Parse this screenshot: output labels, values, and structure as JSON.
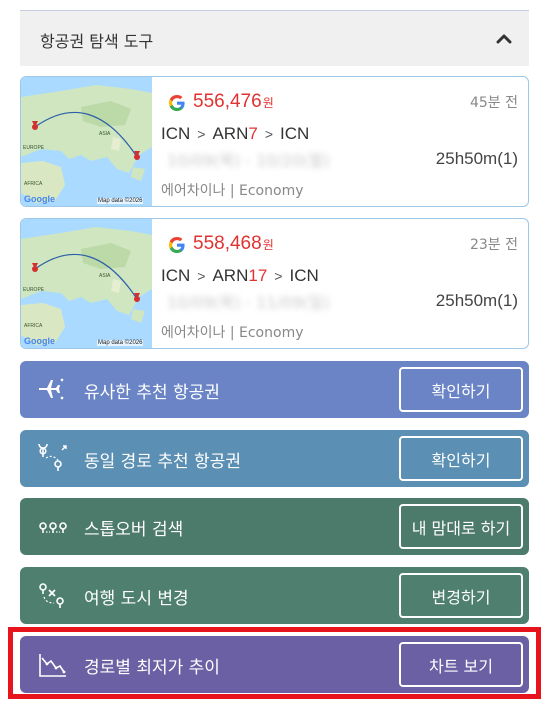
{
  "panel": {
    "title": "항공권 탐색 도구",
    "toggle_icon": "chevron-up-icon"
  },
  "map": {
    "google": "Google",
    "credit": "Map data ©2026",
    "labels": [
      "EUROPE",
      "ASIA",
      "AFRICA"
    ]
  },
  "flights": [
    {
      "price": "556,476",
      "unit": "원",
      "ago": "45분 전",
      "route": {
        "from": "ICN",
        "via": "ARN",
        "stops": "7",
        "to": "ICN"
      },
      "dates_blurred": "10/09(목) - 10/20(월)",
      "duration": "25h50m(1)",
      "airline": "에어차이나 | Economy"
    },
    {
      "price": "558,468",
      "unit": "원",
      "ago": "23분 전",
      "route": {
        "from": "ICN",
        "via": "ARN",
        "stops": "17",
        "to": "ICN"
      },
      "dates_blurred": "10/09(목) - 11/09(일)",
      "duration": "25h50m(1)",
      "airline": "에어차이나 | Economy"
    }
  ],
  "actions": [
    {
      "label": "유사한 추천 항공권",
      "button": "확인하기",
      "color": "#6a84c6",
      "icon": "plane-transfer-icon"
    },
    {
      "label": "동일 경로 추천 항공권",
      "button": "확인하기",
      "color": "#5b8fb3",
      "icon": "route-pins-icon"
    },
    {
      "label": "스톱오버 검색",
      "button": "내 맘대로 하기",
      "color": "#4c7a6b",
      "icon": "stopover-path-icon"
    },
    {
      "label": "여행 도시 변경",
      "button": "변경하기",
      "color": "#4e7f6f",
      "icon": "change-city-icon"
    },
    {
      "label": "경로별 최저가 추이",
      "button": "차트 보기",
      "color": "#6c60a4",
      "icon": "trend-down-icon"
    }
  ],
  "colors": {
    "price_red": "#e03331",
    "highlight_red": "#e8141c",
    "card_border": "#9fc7e6"
  }
}
